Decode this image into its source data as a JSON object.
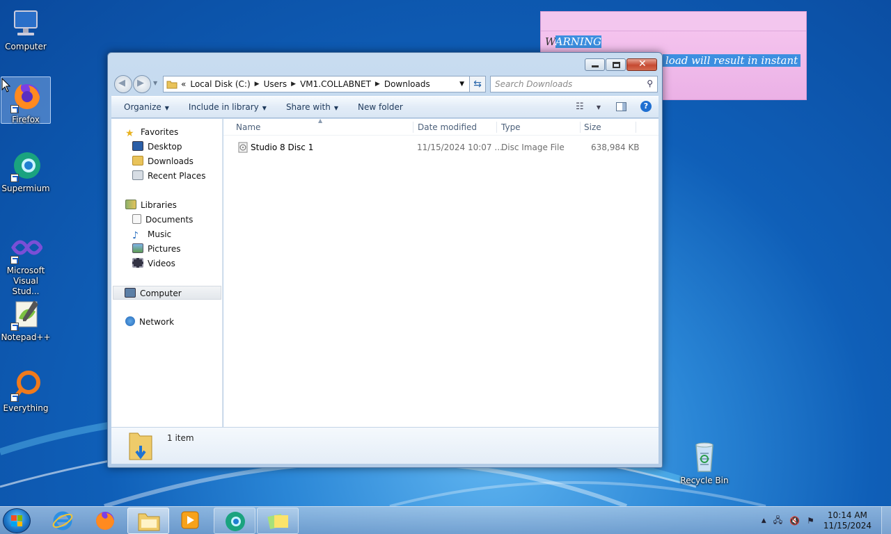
{
  "desktop": {
    "icons": [
      {
        "label": "Computer"
      },
      {
        "label": "Firefox"
      },
      {
        "label": "Supermium"
      },
      {
        "label": "Microsoft Visual Stud..."
      },
      {
        "label": "Notepad++"
      },
      {
        "label": "Everything"
      },
      {
        "label": "Recycle Bin"
      }
    ]
  },
  "sticky": {
    "line1_a": "W",
    "line1_b": "ARNING",
    "line2": "load will result in instant"
  },
  "explorer": {
    "breadcrumb": {
      "overflow": "«",
      "items": [
        "Local Disk (C:)",
        "Users",
        "VM1.COLLABNET",
        "Downloads"
      ]
    },
    "search_placeholder": "Search Downloads",
    "toolbar": {
      "organize": "Organize",
      "include_in_library": "Include in library",
      "share_with": "Share with",
      "new_folder": "New folder"
    },
    "nav": {
      "favorites": "Favorites",
      "desktop": "Desktop",
      "downloads": "Downloads",
      "recent_places": "Recent Places",
      "libraries": "Libraries",
      "documents": "Documents",
      "music": "Music",
      "pictures": "Pictures",
      "videos": "Videos",
      "computer": "Computer",
      "network": "Network"
    },
    "columns": {
      "name": "Name",
      "date_modified": "Date modified",
      "type": "Type",
      "size": "Size"
    },
    "files": [
      {
        "name": "Studio 8 Disc 1",
        "date_modified": "11/15/2024 10:07 ...",
        "type": "Disc Image File",
        "size": "638,984 KB"
      }
    ],
    "status": "1 item"
  },
  "taskbar": {
    "clock_time": "10:14 AM",
    "clock_date": "11/15/2024"
  },
  "colors": {
    "accent": "#3d8fe0",
    "sticky_bg": "#ebb1e6",
    "close_red": "#c64a32"
  }
}
